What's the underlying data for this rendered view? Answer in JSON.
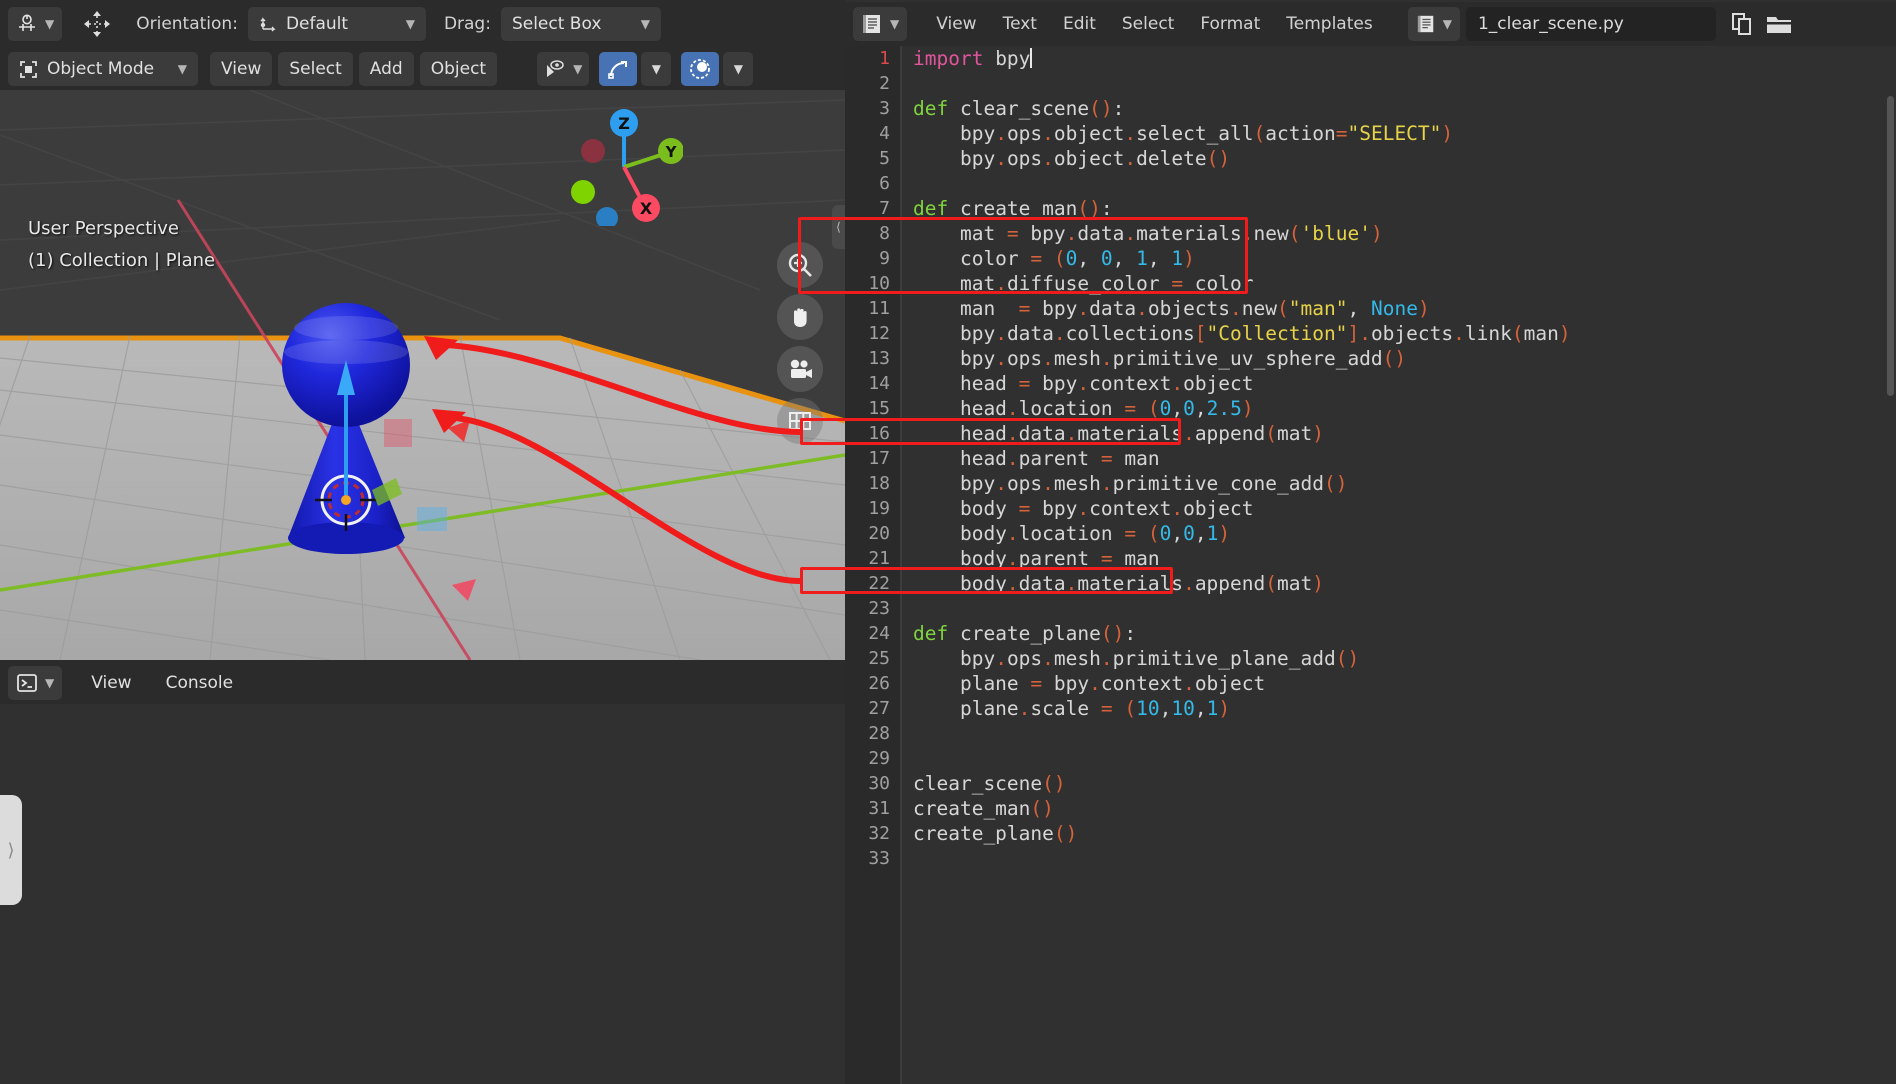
{
  "viewport_header": {
    "row1": {
      "editor_type_icon": "3d-viewport-icon",
      "transform_pivot_icon": "transform-pivot-icon",
      "orientation_label": "Orientation:",
      "orientation_value": "Default",
      "orientation_icon": "orientation-axis-icon",
      "drag_label": "Drag:",
      "drag_value": "Select Box"
    },
    "row2": {
      "mode_icon": "object-mode-icon",
      "mode_value": "Object Mode",
      "menus": [
        "View",
        "Select",
        "Add",
        "Object"
      ],
      "visibility_icon": "object-visibility-icon",
      "snap_icon": "snap-magnet-icon",
      "proportional_icon": "proportional-editing-icon"
    }
  },
  "viewport": {
    "overlay_line1": "User Perspective",
    "overlay_line2": "(1) Collection | Plane",
    "gizmo_axes": [
      {
        "label": "Z",
        "color": "#2e9ff0"
      },
      {
        "label": "Y",
        "color": "#7cbd1e"
      },
      {
        "label": "X",
        "color": "#fb4a62"
      }
    ],
    "tools": [
      {
        "name": "zoom-icon",
        "glyph": "zoom"
      },
      {
        "name": "hand-icon",
        "glyph": "hand"
      },
      {
        "name": "camera-icon",
        "glyph": "camera"
      },
      {
        "name": "orthographic-grid-icon",
        "glyph": "grid"
      }
    ],
    "object_color": "#1a20d8",
    "plane_outline_color": "#e8920f"
  },
  "console_header": {
    "editor_type_icon": "python-console-icon",
    "menus": [
      "View",
      "Console"
    ]
  },
  "text_editor_header": {
    "editor_type_icon": "text-editor-icon",
    "menus": [
      "View",
      "Text",
      "Edit",
      "Select",
      "Format",
      "Templates"
    ],
    "datablock_icon": "text-datablock-icon",
    "filename": "1_clear_scene.py",
    "new_text_icon": "new-text-icon",
    "open_text_icon": "open-text-icon"
  },
  "code": {
    "language": "python",
    "cursor_line": 1,
    "lines": [
      {
        "n": 1,
        "tokens": [
          [
            "imp",
            "import"
          ],
          [
            "txt",
            " bpy"
          ],
          [
            "caret",
            ""
          ]
        ]
      },
      {
        "n": 2,
        "tokens": []
      },
      {
        "n": 3,
        "tokens": [
          [
            "kw",
            "def"
          ],
          [
            "txt",
            " clear_scene"
          ],
          [
            "paren",
            "()"
          ],
          [
            "txt",
            ":"
          ]
        ]
      },
      {
        "n": 4,
        "tokens": [
          [
            "txt",
            "    bpy"
          ],
          [
            "op",
            "."
          ],
          [
            "txt",
            "ops"
          ],
          [
            "op",
            "."
          ],
          [
            "txt",
            "object"
          ],
          [
            "op",
            "."
          ],
          [
            "txt",
            "select_all"
          ],
          [
            "paren",
            "("
          ],
          [
            "txt",
            "action"
          ],
          [
            "op",
            "="
          ],
          [
            "str",
            "\"SELECT\""
          ],
          [
            "paren",
            ")"
          ]
        ]
      },
      {
        "n": 5,
        "tokens": [
          [
            "txt",
            "    bpy"
          ],
          [
            "op",
            "."
          ],
          [
            "txt",
            "ops"
          ],
          [
            "op",
            "."
          ],
          [
            "txt",
            "object"
          ],
          [
            "op",
            "."
          ],
          [
            "txt",
            "delete"
          ],
          [
            "paren",
            "()"
          ]
        ]
      },
      {
        "n": 6,
        "tokens": []
      },
      {
        "n": 7,
        "tokens": [
          [
            "kw",
            "def"
          ],
          [
            "txt",
            " create_man"
          ],
          [
            "paren",
            "()"
          ],
          [
            "txt",
            ":"
          ]
        ]
      },
      {
        "n": 8,
        "tokens": [
          [
            "txt",
            "    mat "
          ],
          [
            "op",
            "="
          ],
          [
            "txt",
            " bpy"
          ],
          [
            "op",
            "."
          ],
          [
            "txt",
            "data"
          ],
          [
            "op",
            "."
          ],
          [
            "txt",
            "materials"
          ],
          [
            "op",
            "."
          ],
          [
            "txt",
            "new"
          ],
          [
            "paren",
            "("
          ],
          [
            "str",
            "'blue'"
          ],
          [
            "paren",
            ")"
          ]
        ]
      },
      {
        "n": 9,
        "tokens": [
          [
            "txt",
            "    color "
          ],
          [
            "op",
            "="
          ],
          [
            "txt",
            " "
          ],
          [
            "paren",
            "("
          ],
          [
            "num",
            "0"
          ],
          [
            "txt",
            ", "
          ],
          [
            "num",
            "0"
          ],
          [
            "txt",
            ", "
          ],
          [
            "num",
            "1"
          ],
          [
            "txt",
            ", "
          ],
          [
            "num",
            "1"
          ],
          [
            "paren",
            ")"
          ]
        ]
      },
      {
        "n": 10,
        "tokens": [
          [
            "txt",
            "    mat"
          ],
          [
            "op",
            "."
          ],
          [
            "txt",
            "diffuse_color "
          ],
          [
            "op",
            "="
          ],
          [
            "txt",
            " color"
          ]
        ]
      },
      {
        "n": 11,
        "tokens": [
          [
            "txt",
            "    man  "
          ],
          [
            "op",
            "="
          ],
          [
            "txt",
            " bpy"
          ],
          [
            "op",
            "."
          ],
          [
            "txt",
            "data"
          ],
          [
            "op",
            "."
          ],
          [
            "txt",
            "objects"
          ],
          [
            "op",
            "."
          ],
          [
            "txt",
            "new"
          ],
          [
            "paren",
            "("
          ],
          [
            "str",
            "\"man\""
          ],
          [
            "txt",
            ", "
          ],
          [
            "bi",
            "None"
          ],
          [
            "paren",
            ")"
          ]
        ]
      },
      {
        "n": 12,
        "tokens": [
          [
            "txt",
            "    bpy"
          ],
          [
            "op",
            "."
          ],
          [
            "txt",
            "data"
          ],
          [
            "op",
            "."
          ],
          [
            "txt",
            "collections"
          ],
          [
            "paren",
            "["
          ],
          [
            "str",
            "\"Collection\""
          ],
          [
            "paren",
            "]"
          ],
          [
            "op",
            "."
          ],
          [
            "txt",
            "objects"
          ],
          [
            "op",
            "."
          ],
          [
            "txt",
            "link"
          ],
          [
            "paren",
            "("
          ],
          [
            "txt",
            "man"
          ],
          [
            "paren",
            ")"
          ]
        ]
      },
      {
        "n": 13,
        "tokens": [
          [
            "txt",
            "    bpy"
          ],
          [
            "op",
            "."
          ],
          [
            "txt",
            "ops"
          ],
          [
            "op",
            "."
          ],
          [
            "txt",
            "mesh"
          ],
          [
            "op",
            "."
          ],
          [
            "txt",
            "primitive_uv_sphere_add"
          ],
          [
            "paren",
            "()"
          ]
        ]
      },
      {
        "n": 14,
        "tokens": [
          [
            "txt",
            "    head "
          ],
          [
            "op",
            "="
          ],
          [
            "txt",
            " bpy"
          ],
          [
            "op",
            "."
          ],
          [
            "txt",
            "context"
          ],
          [
            "op",
            "."
          ],
          [
            "txt",
            "object"
          ]
        ]
      },
      {
        "n": 15,
        "tokens": [
          [
            "txt",
            "    head"
          ],
          [
            "op",
            "."
          ],
          [
            "txt",
            "location "
          ],
          [
            "op",
            "="
          ],
          [
            "txt",
            " "
          ],
          [
            "paren",
            "("
          ],
          [
            "num",
            "0"
          ],
          [
            "txt",
            ","
          ],
          [
            "num",
            "0"
          ],
          [
            "txt",
            ","
          ],
          [
            "num",
            "2.5"
          ],
          [
            "paren",
            ")"
          ]
        ]
      },
      {
        "n": 16,
        "tokens": [
          [
            "txt",
            "    head"
          ],
          [
            "op",
            "."
          ],
          [
            "txt",
            "data"
          ],
          [
            "op",
            "."
          ],
          [
            "txt",
            "materials"
          ],
          [
            "op",
            "."
          ],
          [
            "txt",
            "append"
          ],
          [
            "paren",
            "("
          ],
          [
            "txt",
            "mat"
          ],
          [
            "paren",
            ")"
          ]
        ]
      },
      {
        "n": 17,
        "tokens": [
          [
            "txt",
            "    head"
          ],
          [
            "op",
            "."
          ],
          [
            "txt",
            "parent "
          ],
          [
            "op",
            "="
          ],
          [
            "txt",
            " man"
          ]
        ]
      },
      {
        "n": 18,
        "tokens": [
          [
            "txt",
            "    bpy"
          ],
          [
            "op",
            "."
          ],
          [
            "txt",
            "ops"
          ],
          [
            "op",
            "."
          ],
          [
            "txt",
            "mesh"
          ],
          [
            "op",
            "."
          ],
          [
            "txt",
            "primitive_cone_add"
          ],
          [
            "paren",
            "()"
          ]
        ]
      },
      {
        "n": 19,
        "tokens": [
          [
            "txt",
            "    body "
          ],
          [
            "op",
            "="
          ],
          [
            "txt",
            " bpy"
          ],
          [
            "op",
            "."
          ],
          [
            "txt",
            "context"
          ],
          [
            "op",
            "."
          ],
          [
            "txt",
            "object"
          ]
        ]
      },
      {
        "n": 20,
        "tokens": [
          [
            "txt",
            "    body"
          ],
          [
            "op",
            "."
          ],
          [
            "txt",
            "location "
          ],
          [
            "op",
            "="
          ],
          [
            "txt",
            " "
          ],
          [
            "paren",
            "("
          ],
          [
            "num",
            "0"
          ],
          [
            "txt",
            ","
          ],
          [
            "num",
            "0"
          ],
          [
            "txt",
            ","
          ],
          [
            "num",
            "1"
          ],
          [
            "paren",
            ")"
          ]
        ]
      },
      {
        "n": 21,
        "tokens": [
          [
            "txt",
            "    body"
          ],
          [
            "op",
            "."
          ],
          [
            "txt",
            "parent "
          ],
          [
            "op",
            "="
          ],
          [
            "txt",
            " man"
          ]
        ]
      },
      {
        "n": 22,
        "tokens": [
          [
            "txt",
            "    body"
          ],
          [
            "op",
            "."
          ],
          [
            "txt",
            "data"
          ],
          [
            "op",
            "."
          ],
          [
            "txt",
            "materials"
          ],
          [
            "op",
            "."
          ],
          [
            "txt",
            "append"
          ],
          [
            "paren",
            "("
          ],
          [
            "txt",
            "mat"
          ],
          [
            "paren",
            ")"
          ]
        ]
      },
      {
        "n": 23,
        "tokens": []
      },
      {
        "n": 24,
        "tokens": [
          [
            "kw",
            "def"
          ],
          [
            "txt",
            " create_plane"
          ],
          [
            "paren",
            "()"
          ],
          [
            "txt",
            ":"
          ]
        ]
      },
      {
        "n": 25,
        "tokens": [
          [
            "txt",
            "    bpy"
          ],
          [
            "op",
            "."
          ],
          [
            "txt",
            "ops"
          ],
          [
            "op",
            "."
          ],
          [
            "txt",
            "mesh"
          ],
          [
            "op",
            "."
          ],
          [
            "txt",
            "primitive_plane_add"
          ],
          [
            "paren",
            "()"
          ]
        ]
      },
      {
        "n": 26,
        "tokens": [
          [
            "txt",
            "    plane "
          ],
          [
            "op",
            "="
          ],
          [
            "txt",
            " bpy"
          ],
          [
            "op",
            "."
          ],
          [
            "txt",
            "context"
          ],
          [
            "op",
            "."
          ],
          [
            "txt",
            "object"
          ]
        ]
      },
      {
        "n": 27,
        "tokens": [
          [
            "txt",
            "    plane"
          ],
          [
            "op",
            "."
          ],
          [
            "txt",
            "scale "
          ],
          [
            "op",
            "="
          ],
          [
            "txt",
            " "
          ],
          [
            "paren",
            "("
          ],
          [
            "num",
            "10"
          ],
          [
            "txt",
            ","
          ],
          [
            "num",
            "10"
          ],
          [
            "txt",
            ","
          ],
          [
            "num",
            "1"
          ],
          [
            "paren",
            ")"
          ]
        ]
      },
      {
        "n": 28,
        "tokens": []
      },
      {
        "n": 29,
        "tokens": []
      },
      {
        "n": 30,
        "tokens": [
          [
            "txt",
            "clear_scene"
          ],
          [
            "paren",
            "()"
          ]
        ]
      },
      {
        "n": 31,
        "tokens": [
          [
            "txt",
            "create_man"
          ],
          [
            "paren",
            "()"
          ]
        ]
      },
      {
        "n": 32,
        "tokens": [
          [
            "txt",
            "create_plane"
          ],
          [
            "paren",
            "()"
          ]
        ]
      },
      {
        "n": 33,
        "tokens": []
      }
    ]
  },
  "annotations": {
    "color": "#f01b1b",
    "boxes": [
      {
        "name": "highlight-material-creation",
        "lines": "8-10"
      },
      {
        "name": "highlight-head-material-append",
        "lines": "16"
      },
      {
        "name": "highlight-body-material-append",
        "lines": "22"
      }
    ],
    "arrows": [
      {
        "name": "arrow-to-head-object",
        "from": "line-16",
        "to": "viewport-head"
      },
      {
        "name": "arrow-to-body-object",
        "from": "line-22",
        "to": "viewport-body"
      }
    ]
  },
  "colors": {
    "accent_blue": "#4772b3",
    "header_bg": "#2b2b2b",
    "editor_bg": "#303030",
    "gutter_bg": "#2a2a2a",
    "keyword": "#7fd33f",
    "import": "#e0559b",
    "string": "#e6d34a",
    "number": "#35b9e8",
    "operator": "#d4623a",
    "text": "#d6d6d6"
  }
}
